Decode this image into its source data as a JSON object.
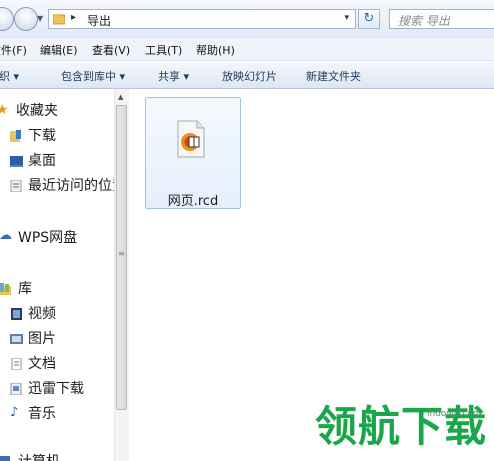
{
  "address": {
    "path": "导出",
    "separator": "▸",
    "dropdown": "▾",
    "refresh": "↻"
  },
  "search": {
    "placeholder": "搜索 导出"
  },
  "menu": [
    "文件(F)",
    "编辑(E)",
    "查看(V)",
    "工具(T)",
    "帮助(H)"
  ],
  "commands": [
    "组织 ▾",
    "包含到库中 ▾",
    "共享 ▾",
    "放映幻灯片",
    "新建文件夹"
  ],
  "nav": {
    "favorites_label": "收藏夹",
    "favorites": [
      "下载",
      "桌面",
      "最近访问的位置"
    ],
    "wps_label": "WPS网盘",
    "library_label": "库",
    "libraries": [
      "视频",
      "图片",
      "文档",
      "迅雷下载",
      "音乐"
    ],
    "computer_label": "计算机"
  },
  "files": [
    {
      "name": "网页.rcd",
      "icon": "rcd-document-icon"
    }
  ],
  "watermark": {
    "text": "领航下载",
    "site": "lhdown.com"
  },
  "colors": {
    "accent": "#1aa64a",
    "selection": "#e4f0fc",
    "selection_border": "#9ec6ea"
  }
}
